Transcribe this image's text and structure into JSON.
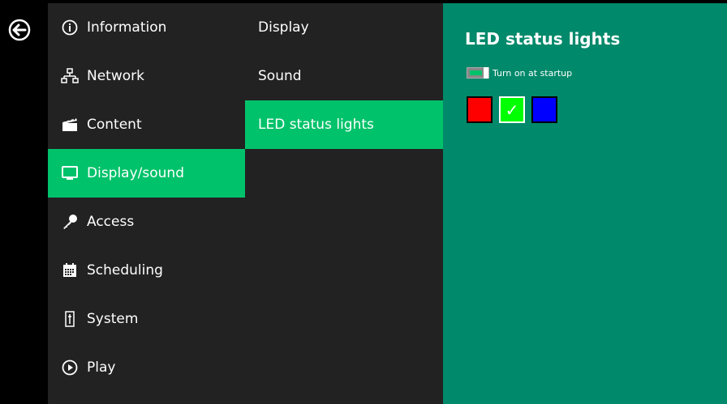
{
  "menu": {
    "items": [
      {
        "label": "Information",
        "icon": "info-icon"
      },
      {
        "label": "Network",
        "icon": "network-icon"
      },
      {
        "label": "Content",
        "icon": "clapperboard-icon"
      },
      {
        "label": "Display/sound",
        "icon": "monitor-icon",
        "active": true
      },
      {
        "label": "Access",
        "icon": "key-icon"
      },
      {
        "label": "Scheduling",
        "icon": "calendar-icon"
      },
      {
        "label": "System",
        "icon": "system-icon"
      },
      {
        "label": "Play",
        "icon": "play-icon"
      }
    ]
  },
  "submenu": {
    "items": [
      {
        "label": "Display"
      },
      {
        "label": "Sound"
      },
      {
        "label": "LED status lights",
        "active": true
      }
    ]
  },
  "panel": {
    "title": "LED status lights",
    "toggle_label": "Turn on at startup",
    "toggle_on": true,
    "colors": [
      {
        "name": "red",
        "hex": "#ff0000",
        "selected": false
      },
      {
        "name": "green",
        "hex": "#00ff00",
        "selected": true
      },
      {
        "name": "blue",
        "hex": "#0000ff",
        "selected": false
      }
    ],
    "check_glyph": "✓"
  },
  "theme": {
    "accent": "#00c26a",
    "panel_bg": "#00896a",
    "menu_bg": "#222222"
  }
}
